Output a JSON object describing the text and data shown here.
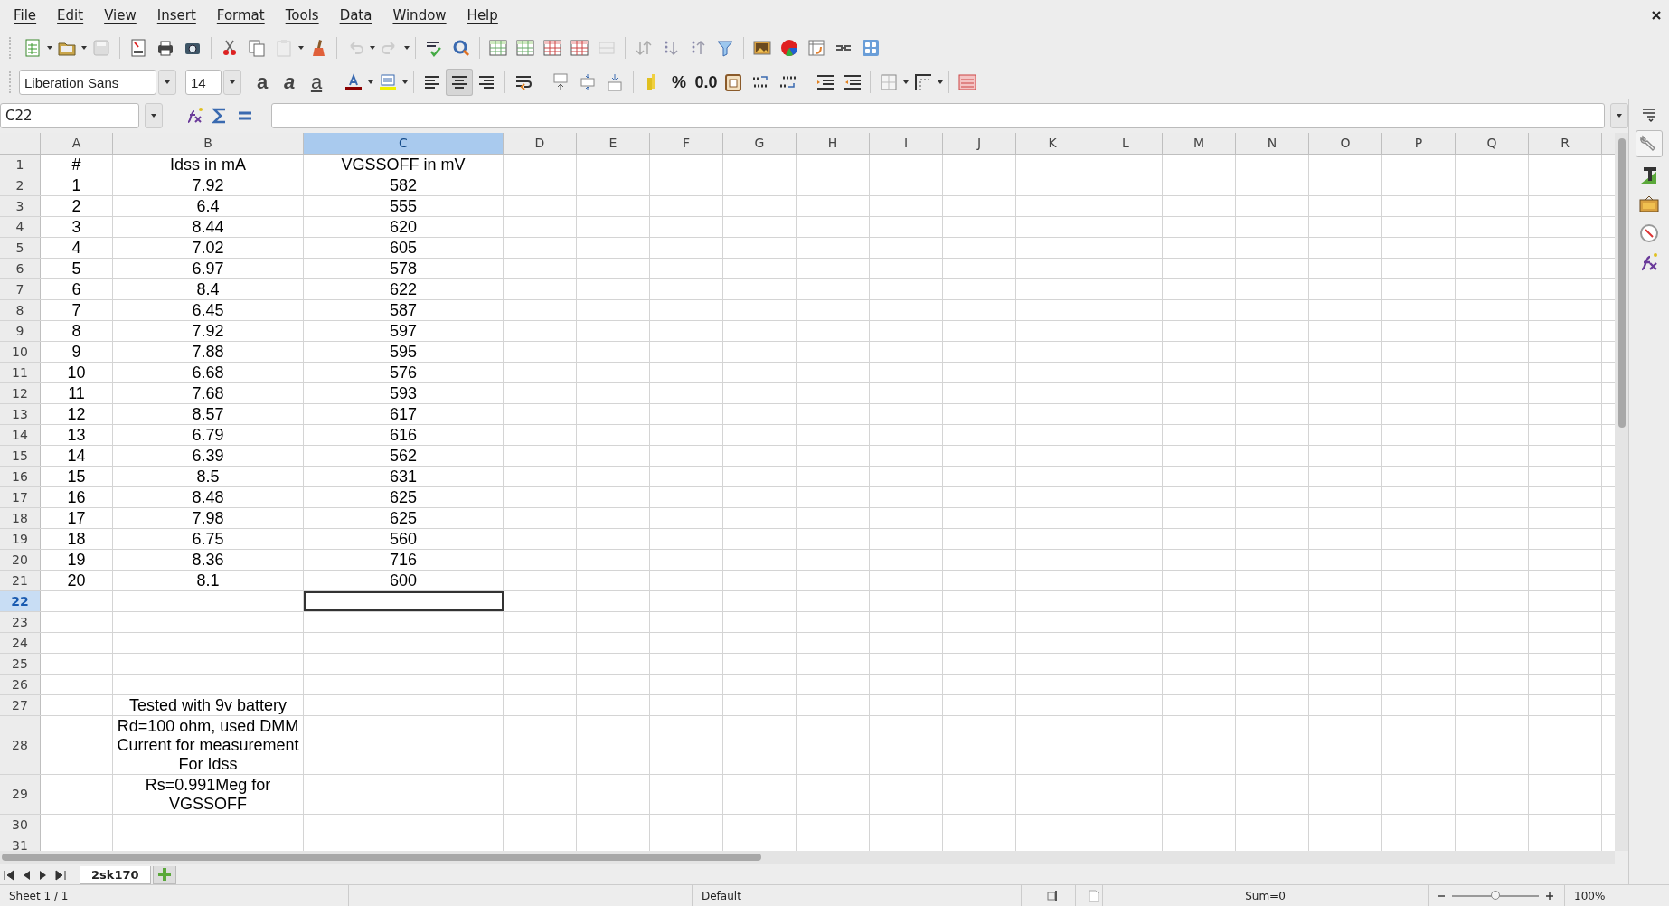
{
  "menu": [
    "File",
    "Edit",
    "View",
    "Insert",
    "Format",
    "Tools",
    "Data",
    "Window",
    "Help"
  ],
  "formatting": {
    "font_name": "Liberation Sans",
    "font_size": "14",
    "text_styles": [
      {
        "kind": "bold",
        "glyph": "a"
      },
      {
        "kind": "italic",
        "glyph": "a"
      },
      {
        "kind": "underline",
        "glyph": "a"
      }
    ],
    "alignment": [
      {
        "kind": "left",
        "selected": false
      },
      {
        "kind": "center",
        "selected": true
      },
      {
        "kind": "right",
        "selected": false
      }
    ],
    "percent": "%",
    "decimal": "0.0"
  },
  "formula_bar": {
    "name_box": "C22"
  },
  "sheet": {
    "columns": [
      {
        "label": "A",
        "selected": false
      },
      {
        "label": "B",
        "selected": false
      },
      {
        "label": "C",
        "selected": true
      },
      {
        "label": "D",
        "selected": false
      },
      {
        "label": "E",
        "selected": false
      },
      {
        "label": "F",
        "selected": false
      },
      {
        "label": "G",
        "selected": false
      },
      {
        "label": "H",
        "selected": false
      },
      {
        "label": "I",
        "selected": false
      },
      {
        "label": "J",
        "selected": false
      },
      {
        "label": "K",
        "selected": false
      },
      {
        "label": "L",
        "selected": false
      },
      {
        "label": "M",
        "selected": false
      },
      {
        "label": "N",
        "selected": false
      },
      {
        "label": "O",
        "selected": false
      },
      {
        "label": "P",
        "selected": false
      },
      {
        "label": "Q",
        "selected": false
      },
      {
        "label": "R",
        "selected": false
      }
    ],
    "rows": [
      {
        "header": "1",
        "selected": false,
        "cells": {
          "A": "#",
          "B": "Idss in mA",
          "C": "VGSSOFF in mV"
        }
      },
      {
        "header": "2",
        "selected": false,
        "cells": {
          "A": "1",
          "B": "7.92",
          "C": "582"
        }
      },
      {
        "header": "3",
        "selected": false,
        "cells": {
          "A": "2",
          "B": "6.4",
          "C": "555"
        }
      },
      {
        "header": "4",
        "selected": false,
        "cells": {
          "A": "3",
          "B": "8.44",
          "C": "620"
        }
      },
      {
        "header": "5",
        "selected": false,
        "cells": {
          "A": "4",
          "B": "7.02",
          "C": "605"
        }
      },
      {
        "header": "6",
        "selected": false,
        "cells": {
          "A": "5",
          "B": "6.97",
          "C": "578"
        }
      },
      {
        "header": "7",
        "selected": false,
        "cells": {
          "A": "6",
          "B": "8.4",
          "C": "622"
        }
      },
      {
        "header": "8",
        "selected": false,
        "cells": {
          "A": "7",
          "B": "6.45",
          "C": "587"
        }
      },
      {
        "header": "9",
        "selected": false,
        "cells": {
          "A": "8",
          "B": "7.92",
          "C": "597"
        }
      },
      {
        "header": "10",
        "selected": false,
        "cells": {
          "A": "9",
          "B": "7.88",
          "C": "595"
        }
      },
      {
        "header": "11",
        "selected": false,
        "cells": {
          "A": "10",
          "B": "6.68",
          "C": "576"
        }
      },
      {
        "header": "12",
        "selected": false,
        "cells": {
          "A": "11",
          "B": "7.68",
          "C": "593"
        }
      },
      {
        "header": "13",
        "selected": false,
        "cells": {
          "A": "12",
          "B": "8.57",
          "C": "617"
        }
      },
      {
        "header": "14",
        "selected": false,
        "cells": {
          "A": "13",
          "B": "6.79",
          "C": "616"
        }
      },
      {
        "header": "15",
        "selected": false,
        "cells": {
          "A": "14",
          "B": "6.39",
          "C": "562"
        }
      },
      {
        "header": "16",
        "selected": false,
        "cells": {
          "A": "15",
          "B": "8.5",
          "C": "631"
        }
      },
      {
        "header": "17",
        "selected": false,
        "cells": {
          "A": "16",
          "B": "8.48",
          "C": "625"
        }
      },
      {
        "header": "18",
        "selected": false,
        "cells": {
          "A": "17",
          "B": "7.98",
          "C": "625"
        }
      },
      {
        "header": "19",
        "selected": false,
        "cells": {
          "A": "18",
          "B": "6.75",
          "C": "560"
        }
      },
      {
        "header": "20",
        "selected": false,
        "cells": {
          "A": "19",
          "B": "8.36",
          "C": "716"
        }
      },
      {
        "header": "21",
        "selected": false,
        "cells": {
          "A": "20",
          "B": "8.1",
          "C": "600"
        }
      },
      {
        "header": "22",
        "selected": true
      },
      {
        "header": "23",
        "selected": false
      },
      {
        "header": "24",
        "selected": false
      },
      {
        "header": "25",
        "selected": false
      },
      {
        "header": "26",
        "selected": false
      },
      {
        "header": "27",
        "selected": false,
        "cells": {
          "B": "Tested with 9v battery"
        }
      },
      {
        "header": "28",
        "selected": false,
        "cells": {
          "B": "Rd=100 ohm, used DMM Current for measurement For Idss"
        }
      },
      {
        "header": "29",
        "selected": false,
        "cells": {
          "B": "Rs=0.991Meg for VGSSOFF"
        }
      },
      {
        "header": "30",
        "selected": false
      },
      {
        "header": "31",
        "selected": false
      }
    ]
  },
  "sheet_tabs": [
    {
      "label": "2sk170",
      "selected": true
    }
  ],
  "status_bar": {
    "sheet": "Sheet 1 / 1",
    "page_style": "Default",
    "sum": "Sum=0",
    "zoom_slider": {
      "level": 0.5
    },
    "zoom_percent": "100%"
  }
}
